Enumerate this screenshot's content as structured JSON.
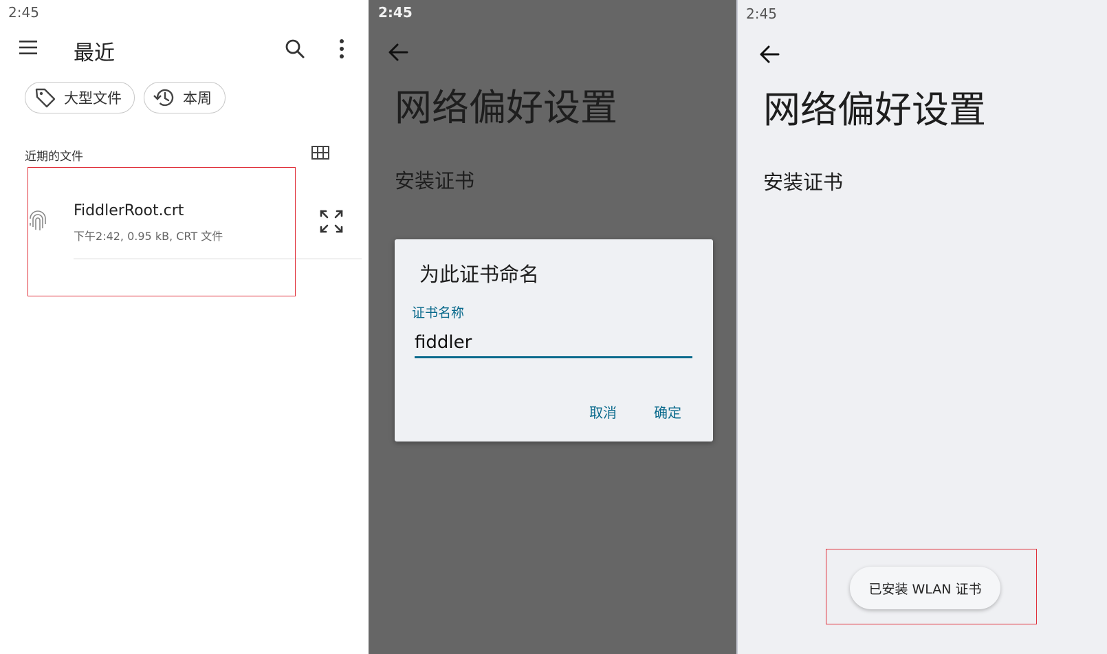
{
  "files_panel": {
    "status_time": "2:45",
    "title": "最近",
    "chips": [
      {
        "label": "大型文件",
        "icon": "tag-icon"
      },
      {
        "label": "本周",
        "icon": "history-icon"
      }
    ],
    "section_label": "近期的文件",
    "file": {
      "name": "FiddlerRoot.crt",
      "meta": "下午2:42, 0.95 kB, CRT 文件",
      "icon": "fingerprint-icon"
    }
  },
  "dialog_panel": {
    "status_time": "2:45",
    "page_title": "网络偏好设置",
    "menu_item": "安装证书",
    "dialog": {
      "title": "为此证书命名",
      "field_label": "证书名称",
      "field_value": "fiddler",
      "cancel": "取消",
      "confirm": "确定"
    }
  },
  "result_panel": {
    "status_time": "2:45",
    "page_title": "网络偏好设置",
    "menu_item": "安装证书",
    "toast": "已安装 WLAN 证书"
  },
  "colors": {
    "accent": "#0a6a8c",
    "highlight_box": "#e0303a",
    "dim_background": "#666666",
    "dialog_background": "#eff1f4"
  }
}
